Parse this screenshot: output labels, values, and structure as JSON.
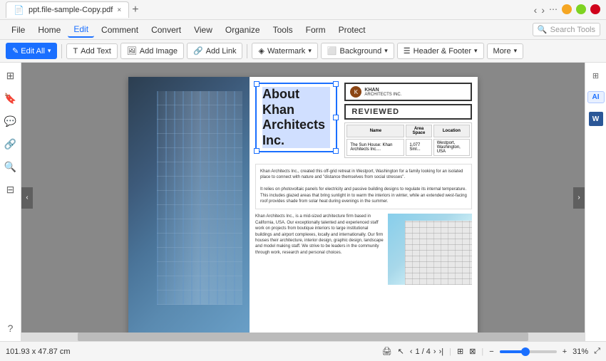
{
  "titlebar": {
    "filename": "ppt.file-sample-Copy.pdf",
    "close_tab": "×",
    "new_tab": "+"
  },
  "menubar": {
    "items": [
      {
        "label": "File",
        "active": false
      },
      {
        "label": "Home",
        "active": false
      },
      {
        "label": "Edit",
        "active": true
      },
      {
        "label": "Comment",
        "active": false
      },
      {
        "label": "Convert",
        "active": false
      },
      {
        "label": "View",
        "active": false
      },
      {
        "label": "Organize",
        "active": false
      },
      {
        "label": "Tools",
        "active": false
      },
      {
        "label": "Form",
        "active": false
      },
      {
        "label": "Protect",
        "active": false
      }
    ],
    "search_placeholder": "Search Tools"
  },
  "toolbar": {
    "edit_all": "✎ Edit All ▾",
    "add_text": "T  Add Text",
    "add_image": "🖼 Add Image",
    "add_link": "🔗 Add Link",
    "watermark": "Watermark ▾",
    "background": "Background ▾",
    "header_footer": "Header & Footer ▾",
    "more": "More ▾"
  },
  "pdf": {
    "title_line1": "About Khan",
    "title_line2": "Architects Inc.",
    "logo_text": "KHAN\nARCHITECTS INC.",
    "reviewed_text": "REVIEWED",
    "table": {
      "headers": [
        "Name",
        "Area Space",
        "Location"
      ],
      "row": [
        "The Sun House: Khan Architects Inc....",
        "1,077 Sml...",
        "Westport, Washington, USA"
      ]
    },
    "description1": "Khan Architects Inc., created this off-grid retreat in Westport, Washington for a family looking for an isolated place to connect with nature and \"distance themselves from social stresses\".",
    "description2": "It relies on photovoltaic panels for electricity and passive building designs to regulate its internal temperature. This includes glazed areas that bring sunlight in to warm the interiors in winter, while an extended west-facing roof provides shade from solar heat during evenings in the summer.",
    "about_text": "Khan Architects Inc., is a mid-sized architecture firm based in California, USA. Our exceptionally talented and experienced staff work on projects from boutique interiors to large institutional buildings and airport complexes, locally and internationally. Our firm houses their architecture, interior design, graphic design, landscape and model making staff. We strive to be leaders in the community through work, research and personal choices."
  },
  "statusbar": {
    "dimensions": "101.93 x 47.87 cm",
    "page_info": "1 / 4",
    "zoom_level": "31%"
  },
  "right_panel": {
    "ai_label": "AI",
    "word_label": "W"
  }
}
